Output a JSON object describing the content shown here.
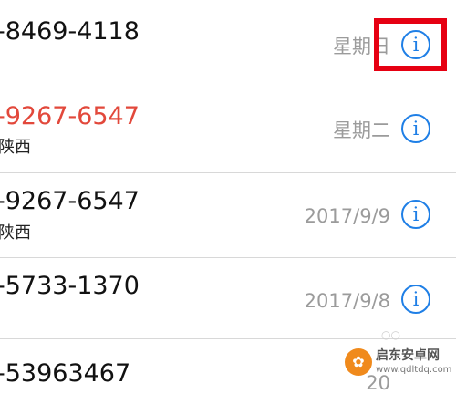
{
  "calls": [
    {
      "number": "-8469-4118",
      "location": "",
      "date": "星期日",
      "missed": false,
      "info_icon": "i"
    },
    {
      "number": "-9267-6547",
      "location": "陕西",
      "date": "星期二",
      "missed": true,
      "info_icon": "i"
    },
    {
      "number": "-9267-6547",
      "location": "陕西",
      "date": "2017/9/9",
      "missed": false,
      "info_icon": "i"
    },
    {
      "number": "-5733-1370",
      "location": "",
      "date": "2017/9/8",
      "missed": false,
      "info_icon": "i"
    },
    {
      "number": "-53963467",
      "location": "",
      "date": "20",
      "missed": false
    }
  ],
  "corner_mark": "○○",
  "watermark": {
    "logo_glyph": "✿",
    "title": "启东安卓网",
    "url": "www.qdltdq.com"
  },
  "colors": {
    "missed": "#e2483b",
    "info": "#1f7fe6",
    "highlight": "#e60012",
    "date": "#9b9b9b"
  }
}
